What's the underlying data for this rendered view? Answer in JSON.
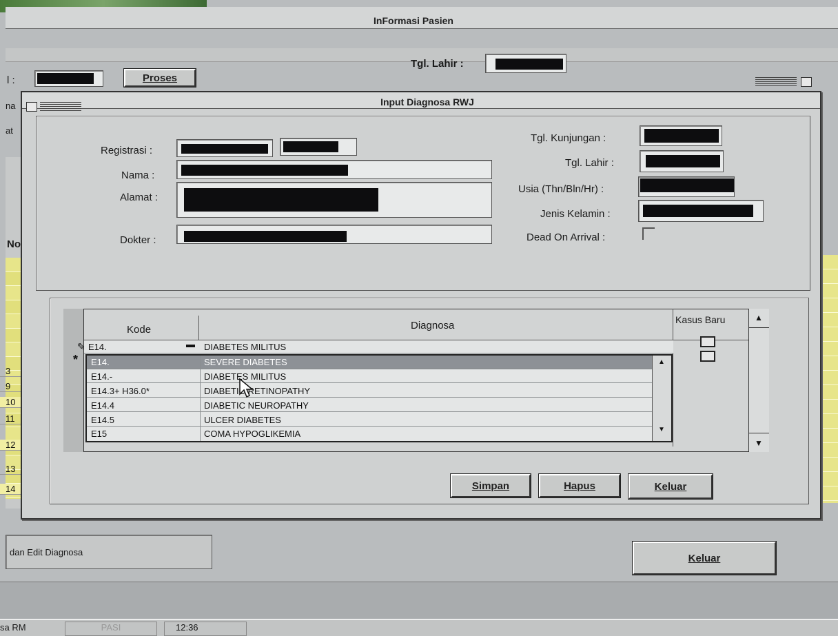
{
  "outer_window": {
    "title": "InFormasi Pasien",
    "proses_label": "Proses",
    "tgl_lahir_label": "Tgl. Lahir :",
    "left_labels": [
      "l  :",
      "na",
      "at"
    ],
    "no_header": "No",
    "row_numbers": [
      "3",
      "9",
      "10",
      "11",
      "12",
      "13",
      "14"
    ],
    "status_text": "dan Edit Diagnosa",
    "keluar_label": "Keluar"
  },
  "dialog": {
    "title": "Input Diagnosa RWJ",
    "labels": {
      "registrasi": "Registrasi  :",
      "nama": "Nama  :",
      "alamat": "Alamat  :",
      "dokter": "Dokter  :",
      "tgl_kunjungan": "Tgl. Kunjungan :",
      "tgl_lahir": "Tgl. Lahir :",
      "usia": "Usia (Thn/Bln/Hr) :",
      "jenis_kelamin": "Jenis Kelamin :",
      "doa": "Dead On Arrival :"
    },
    "grid": {
      "columns": [
        "Kode",
        "Diagnosa",
        "Kasus Baru"
      ],
      "current_row": {
        "kode": "E14.",
        "diagnosa": "DIABETES MILITUS"
      },
      "new_row_marker": "*",
      "dropdown_items": [
        {
          "kode": "E14.",
          "diagnosa": "SEVERE DIABETES"
        },
        {
          "kode": "E14.-",
          "diagnosa": "DIABETES MILITUS"
        },
        {
          "kode": "E14.3+ H36.0*",
          "diagnosa": "DIABETIC RETINOPATHY"
        },
        {
          "kode": "E14.4",
          "diagnosa": "DIABETIC NEUROPATHY"
        },
        {
          "kode": "E14.5",
          "diagnosa": "ULCER DIABETES"
        },
        {
          "kode": "E15",
          "diagnosa": "COMA HYPOGLIKEMIA"
        }
      ]
    },
    "buttons": {
      "simpan": "Simpan",
      "hapus": "Hapus",
      "keluar": "Keluar"
    }
  },
  "taskbar": {
    "label": "sa RM",
    "pasien": "PASI",
    "time": "12:36"
  },
  "icons": [
    "pencil-icon",
    "mouse-cursor-icon",
    "scroll-up-icon",
    "scroll-down-icon",
    "dropdown-arrow-icon",
    "system-menu-icon"
  ]
}
